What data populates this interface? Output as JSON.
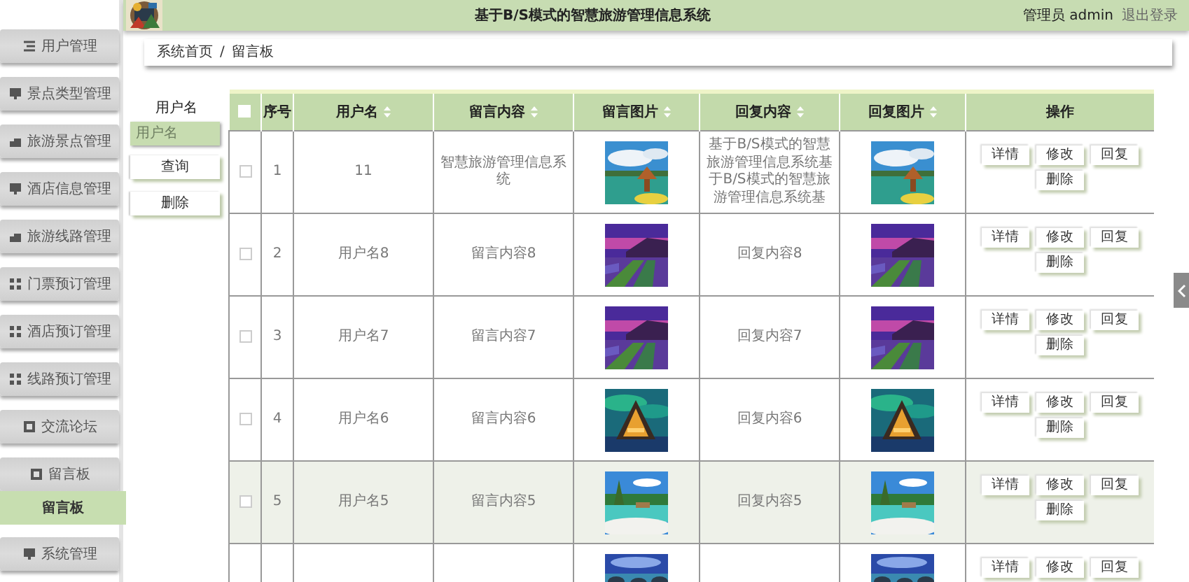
{
  "header": {
    "title": "基于B/S模式的智慧旅游管理信息系统",
    "user": "管理员 admin",
    "logout": "退出登录"
  },
  "sidebar": {
    "items": [
      {
        "label": "用户管理"
      },
      {
        "label": "景点类型管理"
      },
      {
        "label": "旅游景点管理"
      },
      {
        "label": "酒店信息管理"
      },
      {
        "label": "旅游线路管理"
      },
      {
        "label": "门票预订管理"
      },
      {
        "label": "酒店预订管理"
      },
      {
        "label": "线路预订管理"
      },
      {
        "label": "交流论坛"
      },
      {
        "label": "留言板",
        "children": [
          {
            "label": "留言板",
            "selected": true
          }
        ]
      },
      {
        "label": "系统管理"
      }
    ]
  },
  "breadcrumb": {
    "items": [
      "系统首页",
      "留言板"
    ],
    "separator": "/"
  },
  "search": {
    "label": "用户名",
    "placeholder": "用户名",
    "buttons": [
      "查询",
      "删除"
    ]
  },
  "table": {
    "select_all": {
      "checked": false
    },
    "columns": [
      {
        "label": "序号",
        "sortable": false
      },
      {
        "label": "用户名",
        "sortable": true
      },
      {
        "label": "留言内容",
        "sortable": true
      },
      {
        "label": "留言图片",
        "sortable": true
      },
      {
        "label": "回复内容",
        "sortable": true
      },
      {
        "label": "回复图片",
        "sortable": true
      },
      {
        "label": "操作",
        "sortable": false
      }
    ],
    "rows": [
      {
        "checked": false,
        "highlighted": false,
        "number": "1",
        "username": "11",
        "content": "智慧旅游管理信息系统",
        "image": {
          "kind": "picture"
        },
        "reply": "基于B/S模式的智慧旅游管理信息系统基于B/S模式的智慧旅游管理信息系统基",
        "reply_image": {
          "kind": "picture"
        },
        "actions": [
          "详情",
          "修改",
          "回复",
          "删除"
        ]
      },
      {
        "checked": false,
        "highlighted": false,
        "number": "2",
        "username": "用户名8",
        "content": "留言内容8",
        "image": {
          "kind": "picture"
        },
        "reply": "回复内容8",
        "reply_image": {
          "kind": "picture"
        },
        "actions": [
          "详情",
          "修改",
          "回复",
          "删除"
        ]
      },
      {
        "checked": false,
        "highlighted": false,
        "number": "3",
        "username": "用户名7",
        "content": "留言内容7",
        "image": {
          "kind": "picture"
        },
        "reply": "回复内容7",
        "reply_image": {
          "kind": "picture"
        },
        "actions": [
          "详情",
          "修改",
          "回复",
          "删除"
        ]
      },
      {
        "checked": false,
        "highlighted": false,
        "number": "4",
        "username": "用户名6",
        "content": "留言内容6",
        "image": {
          "kind": "picture"
        },
        "reply": "回复内容6",
        "reply_image": {
          "kind": "picture"
        },
        "actions": [
          "详情",
          "修改",
          "回复",
          "删除"
        ]
      },
      {
        "checked": false,
        "highlighted": true,
        "number": "5",
        "username": "用户名5",
        "content": "留言内容5",
        "image": {
          "kind": "picture"
        },
        "reply": "回复内容5",
        "reply_image": {
          "kind": "picture"
        },
        "actions": [
          "详情",
          "修改",
          "回复",
          "删除"
        ]
      },
      {
        "image": {
          "kind": "picture"
        },
        "reply_image": {
          "kind": "picture"
        },
        "actions": [
          "详情",
          "修改",
          "回复"
        ]
      }
    ]
  }
}
